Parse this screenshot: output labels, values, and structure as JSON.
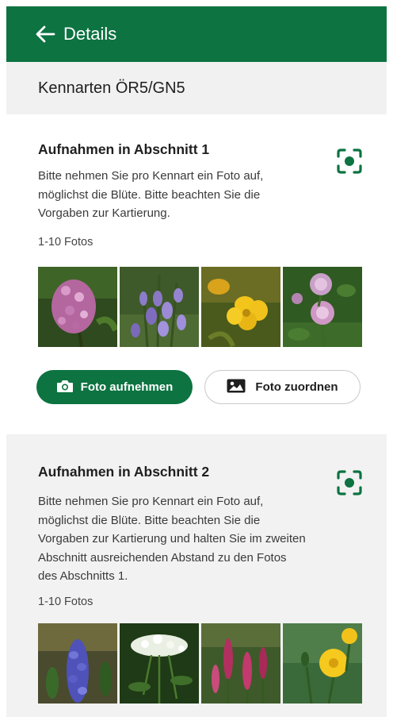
{
  "header": {
    "title": "Details",
    "back_icon": "arrow-left-icon"
  },
  "subheader": {
    "title": "Kennarten ÖR5/GN5"
  },
  "colors": {
    "brand": "#0c7341",
    "section_bg": "#f2f2f2"
  },
  "sections": [
    {
      "title": "Aufnahmen in Abschnitt 1",
      "description": "Bitte nehmen Sie pro Kennart ein Foto auf, möglichst die Blüte. Bitte beachten Sie die Vorgaben zur Kartierung.",
      "count": "1-10 Fotos",
      "scan_icon": "focus-scan-icon",
      "photos": [
        "lilac-flower-photo",
        "bluebell-flower-photo",
        "yellow-celandine-photo",
        "clover-flower-photo"
      ],
      "take_photo_label": "Foto aufnehmen",
      "assign_photo_label": "Foto zuordnen"
    },
    {
      "title": "Aufnahmen in Abschnitt 2",
      "description": "Bitte nehmen Sie pro Kennart ein Foto auf, möglichst die Blüte. Bitte beachten Sie die Vorgaben zur Kartierung und halten Sie im zweiten Abschnitt ausreichenden Abstand zu den Fotos des Abschnitts 1.",
      "count": "1-10 Fotos",
      "scan_icon": "focus-scan-icon",
      "photos": [
        "lupine-flower-photo",
        "yarrow-flower-photo",
        "knotweed-flower-photo",
        "buttercup-flower-photo"
      ]
    }
  ]
}
